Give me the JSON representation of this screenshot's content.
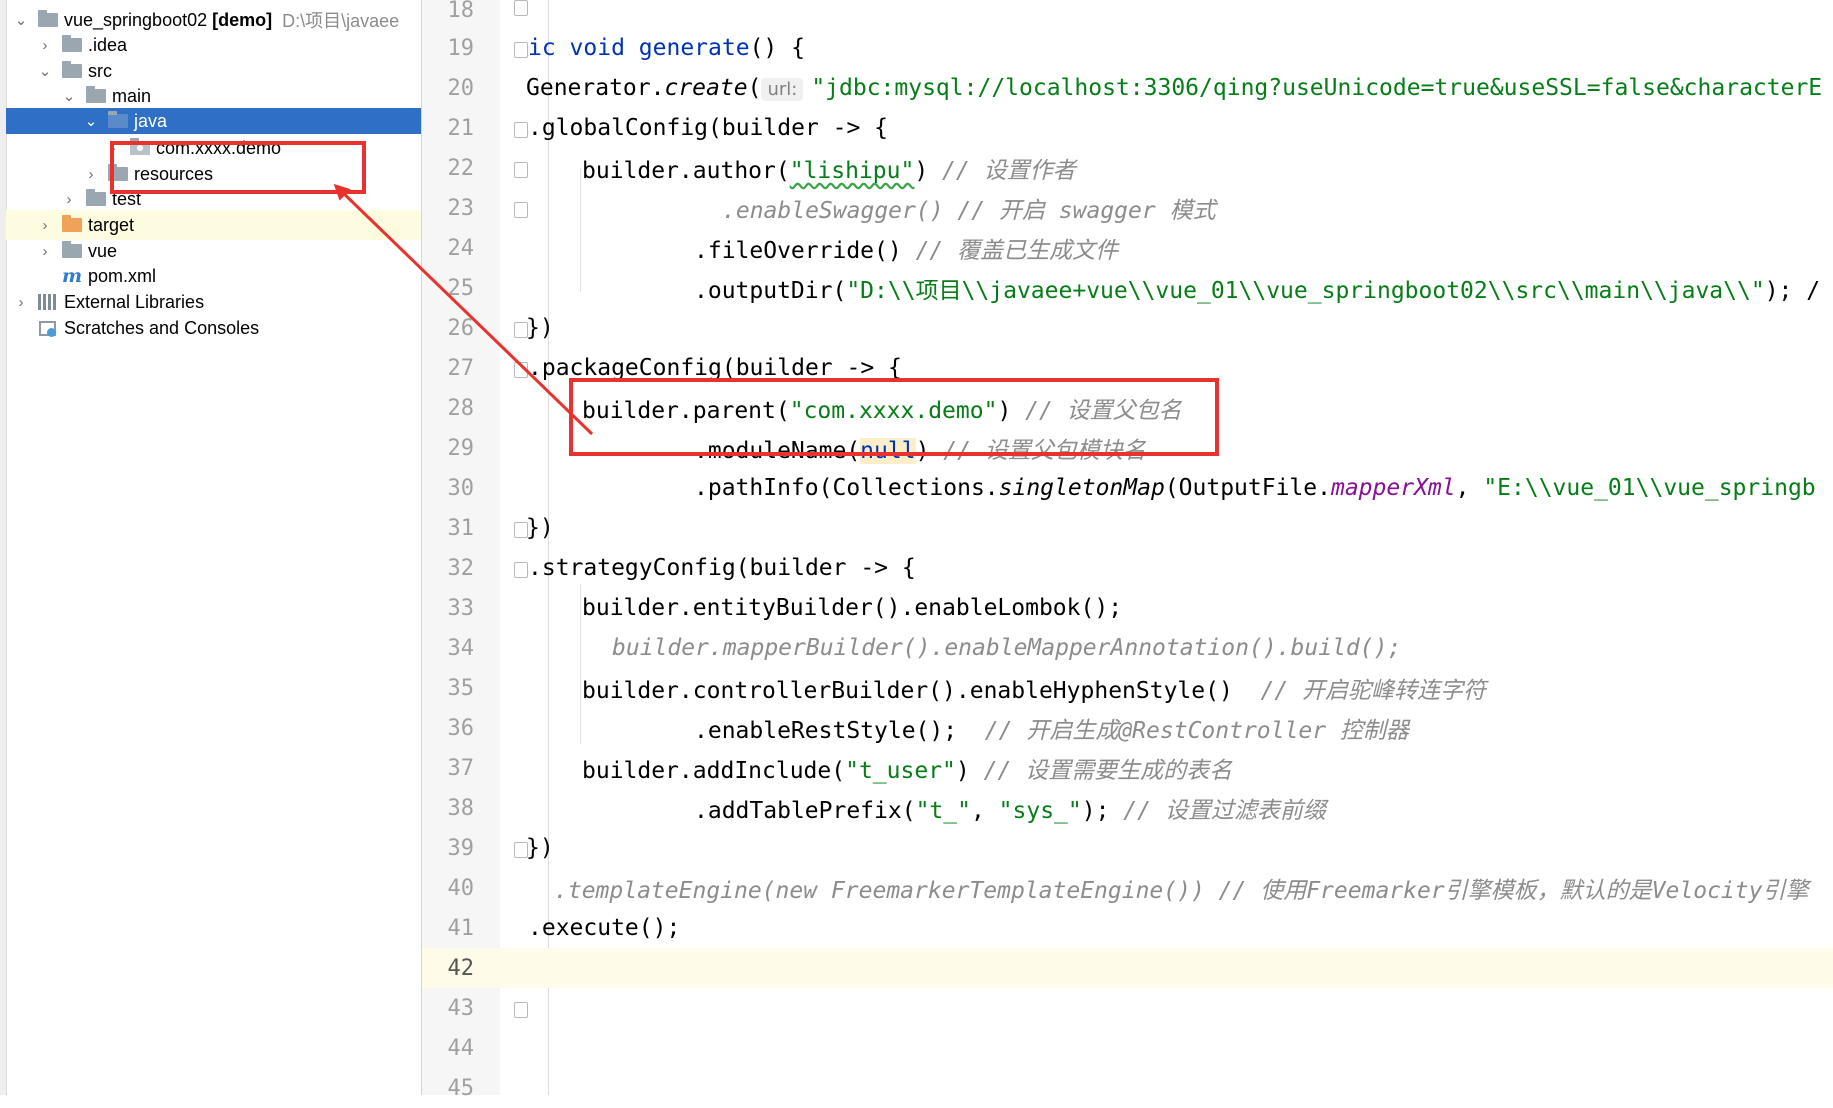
{
  "project_tree": {
    "root": {
      "name": "vue_springboot02",
      "module": "[demo]",
      "path": "D:\\项目\\javaee"
    },
    "items": [
      {
        "label": ".idea"
      },
      {
        "label": "src"
      },
      {
        "label": "main"
      },
      {
        "label": "java"
      },
      {
        "label": "com.xxxx.demo"
      },
      {
        "label": "resources"
      },
      {
        "label": "test"
      },
      {
        "label": "target"
      },
      {
        "label": "vue"
      },
      {
        "label": "pom.xml"
      },
      {
        "label": "External Libraries"
      },
      {
        "label": "Scratches and Consoles"
      }
    ]
  },
  "editor": {
    "line_numbers": [
      "18",
      "19",
      "20",
      "21",
      "22",
      "23",
      "24",
      "25",
      "26",
      "27",
      "28",
      "29",
      "30",
      "31",
      "32",
      "33",
      "34",
      "35",
      "36",
      "37",
      "38",
      "39",
      "40",
      "41",
      "42",
      "43",
      "44",
      "45"
    ],
    "current_line": "42",
    "code": {
      "l19": {
        "a": "ic void ",
        "b": "generate",
        "c": "() {"
      },
      "l20": {
        "a": "Generator.",
        "b": "create",
        "c": "(",
        "hint": "url:",
        "d": "\"jdbc:mysql://localhost:3306/qing?useUnicode=true&useSSL=false&characterE"
      },
      "l21": {
        "a": ".globalConfig(builder -> {"
      },
      "l22": {
        "a": "builder.author(",
        "b": "\"lishipu\"",
        "c": ") ",
        "d": "// 设置作者"
      },
      "l23": {
        "a": ".enableSwagger() // 开启 swagger 模式"
      },
      "l24": {
        "a": ".fileOverride() ",
        "b": "// 覆盖已生成文件"
      },
      "l25": {
        "a": ".outputDir(",
        "b": "\"D:\\\\项目\\\\javaee+vue\\\\vue_01\\\\vue_springboot02\\\\src\\\\main\\\\java\\\\\"",
        "c": "); /"
      },
      "l26": {
        "a": "})"
      },
      "l27": {
        "a": ".packageConfig(builder -> {"
      },
      "l28": {
        "a": "builder.parent(",
        "b": "\"com.xxxx.demo\"",
        "c": ") ",
        "d": "// 设置父包名"
      },
      "l29": {
        "a": ".moduleName(",
        "b": "null",
        "c": ") ",
        "d": "// 设置父包模块名"
      },
      "l30": {
        "a": ".pathInfo(Collections.",
        "b": "singletonMap",
        "c": "(OutputFile.",
        "d": "mapperXml",
        "e": ", ",
        "f": "\"E:\\\\vue_01\\\\vue_springb"
      },
      "l31": {
        "a": "})"
      },
      "l32": {
        "a": ".strategyConfig(builder -> {"
      },
      "l33": {
        "a": "builder.entityBuilder().enableLombok();"
      },
      "l34": {
        "a": "builder.mapperBuilder().enableMapperAnnotation().build();"
      },
      "l35": {
        "a": "builder.controllerBuilder().enableHyphenStyle()  ",
        "b": "// 开启驼峰转连字符"
      },
      "l36": {
        "a": ".enableRestStyle();  ",
        "b": "// 开启生成@RestController 控制器"
      },
      "l37": {
        "a": "builder.addInclude(",
        "b": "\"t_user\"",
        "c": ") ",
        "d": "// 设置需要生成的表名"
      },
      "l38": {
        "a": ".addTablePrefix(",
        "b": "\"t_\"",
        "c": ", ",
        "d": "\"sys_\"",
        "e": "); ",
        "f": "// 设置过滤表前缀"
      },
      "l39": {
        "a": "})"
      },
      "l40": {
        "a": ".templateEngine(new FreemarkerTemplateEngine()) // 使用Freemarker引擎模板，默认的是Velocity引擎"
      },
      "l41": {
        "a": ".execute();"
      }
    }
  },
  "annotation": {
    "color": "#e8322d"
  }
}
